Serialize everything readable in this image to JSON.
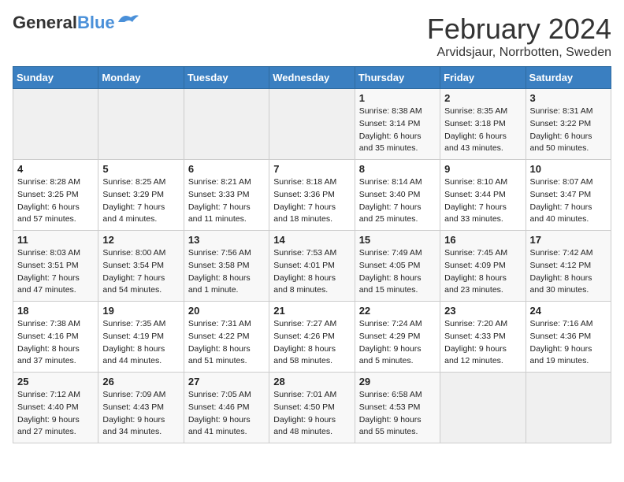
{
  "logo": {
    "text1": "General",
    "text2": "Blue"
  },
  "title": "February 2024",
  "location": "Arvidsjaur, Norrbotten, Sweden",
  "days_header": [
    "Sunday",
    "Monday",
    "Tuesday",
    "Wednesday",
    "Thursday",
    "Friday",
    "Saturday"
  ],
  "weeks": [
    [
      {
        "day": "",
        "info": ""
      },
      {
        "day": "",
        "info": ""
      },
      {
        "day": "",
        "info": ""
      },
      {
        "day": "",
        "info": ""
      },
      {
        "day": "1",
        "info": "Sunrise: 8:38 AM\nSunset: 3:14 PM\nDaylight: 6 hours\nand 35 minutes."
      },
      {
        "day": "2",
        "info": "Sunrise: 8:35 AM\nSunset: 3:18 PM\nDaylight: 6 hours\nand 43 minutes."
      },
      {
        "day": "3",
        "info": "Sunrise: 8:31 AM\nSunset: 3:22 PM\nDaylight: 6 hours\nand 50 minutes."
      }
    ],
    [
      {
        "day": "4",
        "info": "Sunrise: 8:28 AM\nSunset: 3:25 PM\nDaylight: 6 hours\nand 57 minutes."
      },
      {
        "day": "5",
        "info": "Sunrise: 8:25 AM\nSunset: 3:29 PM\nDaylight: 7 hours\nand 4 minutes."
      },
      {
        "day": "6",
        "info": "Sunrise: 8:21 AM\nSunset: 3:33 PM\nDaylight: 7 hours\nand 11 minutes."
      },
      {
        "day": "7",
        "info": "Sunrise: 8:18 AM\nSunset: 3:36 PM\nDaylight: 7 hours\nand 18 minutes."
      },
      {
        "day": "8",
        "info": "Sunrise: 8:14 AM\nSunset: 3:40 PM\nDaylight: 7 hours\nand 25 minutes."
      },
      {
        "day": "9",
        "info": "Sunrise: 8:10 AM\nSunset: 3:44 PM\nDaylight: 7 hours\nand 33 minutes."
      },
      {
        "day": "10",
        "info": "Sunrise: 8:07 AM\nSunset: 3:47 PM\nDaylight: 7 hours\nand 40 minutes."
      }
    ],
    [
      {
        "day": "11",
        "info": "Sunrise: 8:03 AM\nSunset: 3:51 PM\nDaylight: 7 hours\nand 47 minutes."
      },
      {
        "day": "12",
        "info": "Sunrise: 8:00 AM\nSunset: 3:54 PM\nDaylight: 7 hours\nand 54 minutes."
      },
      {
        "day": "13",
        "info": "Sunrise: 7:56 AM\nSunset: 3:58 PM\nDaylight: 8 hours\nand 1 minute."
      },
      {
        "day": "14",
        "info": "Sunrise: 7:53 AM\nSunset: 4:01 PM\nDaylight: 8 hours\nand 8 minutes."
      },
      {
        "day": "15",
        "info": "Sunrise: 7:49 AM\nSunset: 4:05 PM\nDaylight: 8 hours\nand 15 minutes."
      },
      {
        "day": "16",
        "info": "Sunrise: 7:45 AM\nSunset: 4:09 PM\nDaylight: 8 hours\nand 23 minutes."
      },
      {
        "day": "17",
        "info": "Sunrise: 7:42 AM\nSunset: 4:12 PM\nDaylight: 8 hours\nand 30 minutes."
      }
    ],
    [
      {
        "day": "18",
        "info": "Sunrise: 7:38 AM\nSunset: 4:16 PM\nDaylight: 8 hours\nand 37 minutes."
      },
      {
        "day": "19",
        "info": "Sunrise: 7:35 AM\nSunset: 4:19 PM\nDaylight: 8 hours\nand 44 minutes."
      },
      {
        "day": "20",
        "info": "Sunrise: 7:31 AM\nSunset: 4:22 PM\nDaylight: 8 hours\nand 51 minutes."
      },
      {
        "day": "21",
        "info": "Sunrise: 7:27 AM\nSunset: 4:26 PM\nDaylight: 8 hours\nand 58 minutes."
      },
      {
        "day": "22",
        "info": "Sunrise: 7:24 AM\nSunset: 4:29 PM\nDaylight: 9 hours\nand 5 minutes."
      },
      {
        "day": "23",
        "info": "Sunrise: 7:20 AM\nSunset: 4:33 PM\nDaylight: 9 hours\nand 12 minutes."
      },
      {
        "day": "24",
        "info": "Sunrise: 7:16 AM\nSunset: 4:36 PM\nDaylight: 9 hours\nand 19 minutes."
      }
    ],
    [
      {
        "day": "25",
        "info": "Sunrise: 7:12 AM\nSunset: 4:40 PM\nDaylight: 9 hours\nand 27 minutes."
      },
      {
        "day": "26",
        "info": "Sunrise: 7:09 AM\nSunset: 4:43 PM\nDaylight: 9 hours\nand 34 minutes."
      },
      {
        "day": "27",
        "info": "Sunrise: 7:05 AM\nSunset: 4:46 PM\nDaylight: 9 hours\nand 41 minutes."
      },
      {
        "day": "28",
        "info": "Sunrise: 7:01 AM\nSunset: 4:50 PM\nDaylight: 9 hours\nand 48 minutes."
      },
      {
        "day": "29",
        "info": "Sunrise: 6:58 AM\nSunset: 4:53 PM\nDaylight: 9 hours\nand 55 minutes."
      },
      {
        "day": "",
        "info": ""
      },
      {
        "day": "",
        "info": ""
      }
    ]
  ]
}
